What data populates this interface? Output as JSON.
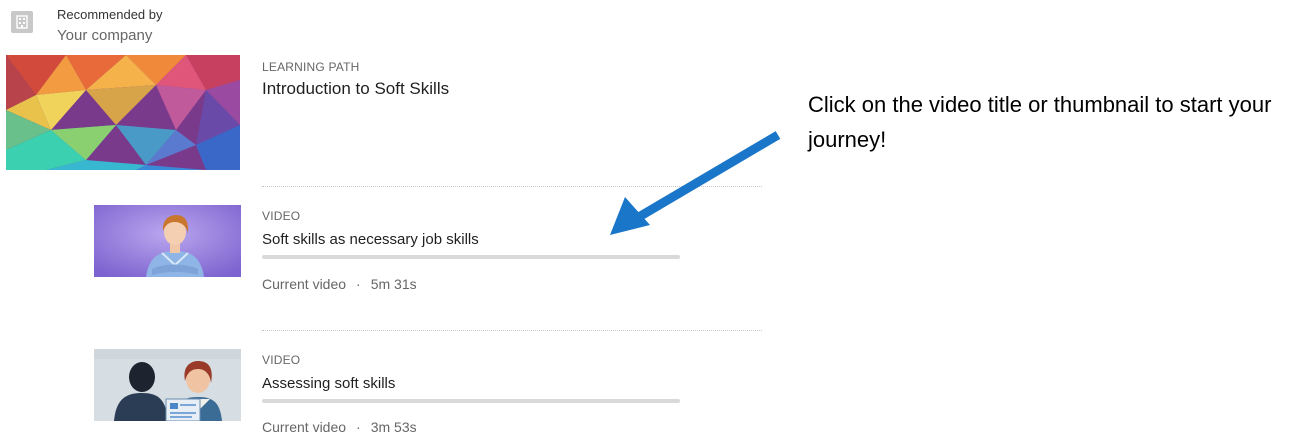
{
  "recommendation": {
    "label": "Recommended by",
    "source": "Your company",
    "icon": "building-icon"
  },
  "learning_path": {
    "kicker": "LEARNING PATH",
    "title": "Introduction to Soft Skills",
    "thumbnail": "colorful-polygon-thumbnail"
  },
  "videos": [
    {
      "kicker": "VIDEO",
      "title": "Soft skills as necessary job skills",
      "status": "Current video",
      "separator": "·",
      "duration": "5m 31s",
      "progress": 0,
      "thumbnail": "instructor-thumbnail"
    },
    {
      "kicker": "VIDEO",
      "title": "Assessing soft skills",
      "status": "Current video",
      "separator": "·",
      "duration": "3m 53s",
      "progress": 0,
      "thumbnail": "interview-illustration-thumbnail"
    }
  ],
  "annotation": {
    "text": "Click on the video title or thumbnail to start your journey!",
    "arrow_color": "#1976c8"
  },
  "colors": {
    "progress_track": "#d9d9d9",
    "accent": "#0a66c2"
  }
}
